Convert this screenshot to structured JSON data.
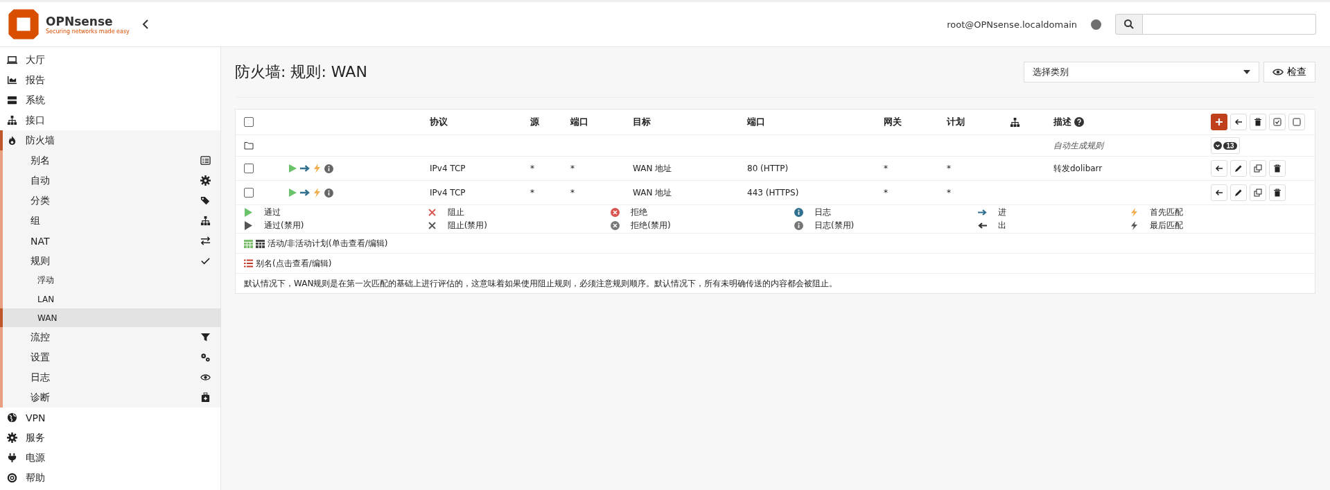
{
  "brand": {
    "name": "OPNsense",
    "tagline": "Securing networks made easy"
  },
  "header": {
    "user": "root@OPNsense.localdomain"
  },
  "sidebar": {
    "items": [
      {
        "label": "大厅",
        "selected": false
      },
      {
        "label": "报告",
        "selected": false
      },
      {
        "label": "系统",
        "selected": false
      },
      {
        "label": "接口",
        "selected": false
      },
      {
        "label": "防火墙",
        "selected": false,
        "expanded": true,
        "children": [
          {
            "label": "别名",
            "selected": false
          },
          {
            "label": "自动",
            "selected": false
          },
          {
            "label": "分类",
            "selected": false
          },
          {
            "label": "组",
            "selected": false
          },
          {
            "label": "NAT",
            "selected": false
          },
          {
            "label": "规则",
            "selected": false,
            "expanded": true,
            "children": [
              {
                "label": "浮动",
                "selected": false
              },
              {
                "label": "LAN",
                "selected": false
              },
              {
                "label": "WAN",
                "selected": true
              }
            ]
          },
          {
            "label": "流控",
            "selected": false
          },
          {
            "label": "设置",
            "selected": false
          },
          {
            "label": "日志",
            "selected": false
          },
          {
            "label": "诊断",
            "selected": false
          }
        ]
      },
      {
        "label": "VPN",
        "selected": false
      },
      {
        "label": "服务",
        "selected": false
      },
      {
        "label": "电源",
        "selected": false
      },
      {
        "label": "帮助",
        "selected": false
      }
    ]
  },
  "page": {
    "title": "防火墙: 规则: WAN",
    "category_select": {
      "placeholder": "选择类别"
    },
    "inspect_button": "检查"
  },
  "table": {
    "header_checked": false,
    "columns": [
      "协议",
      "源",
      "端口",
      "目标",
      "端口",
      "网关",
      "计划",
      "描述"
    ],
    "group_row": {
      "description": "自动生成规则",
      "count": "13"
    },
    "rows": [
      {
        "checked": false,
        "protocol": "IPv4 TCP",
        "source": "*",
        "source_port": "*",
        "destination": "WAN 地址",
        "destination_port": "80 (HTTP)",
        "gateway": "*",
        "schedule": "*",
        "description": "转发dolibarr"
      },
      {
        "checked": false,
        "protocol": "IPv4 TCP",
        "source": "*",
        "source_port": "*",
        "destination": "WAN 地址",
        "destination_port": "443 (HTTPS)",
        "gateway": "*",
        "schedule": "*",
        "description": ""
      }
    ]
  },
  "legend": [
    [
      "通过",
      "阻止",
      "拒绝",
      "日志",
      "进",
      "首先匹配"
    ],
    [
      "通过(禁用)",
      "阻止(禁用)",
      "拒绝(禁用)",
      "日志(禁用)",
      "出",
      "最后匹配"
    ]
  ],
  "schedules_note": "活动/非活动计划(单击查看/编辑)",
  "aliases_note": "别名(点击查看/编辑)",
  "footer_note": "默认情况下，WAN规则是在第一次匹配的基础上进行评估的，这意味着如果使用阻止规则，必须注意规则顺序。默认情况下，所有未明确传送的内容都会被阻止。"
}
